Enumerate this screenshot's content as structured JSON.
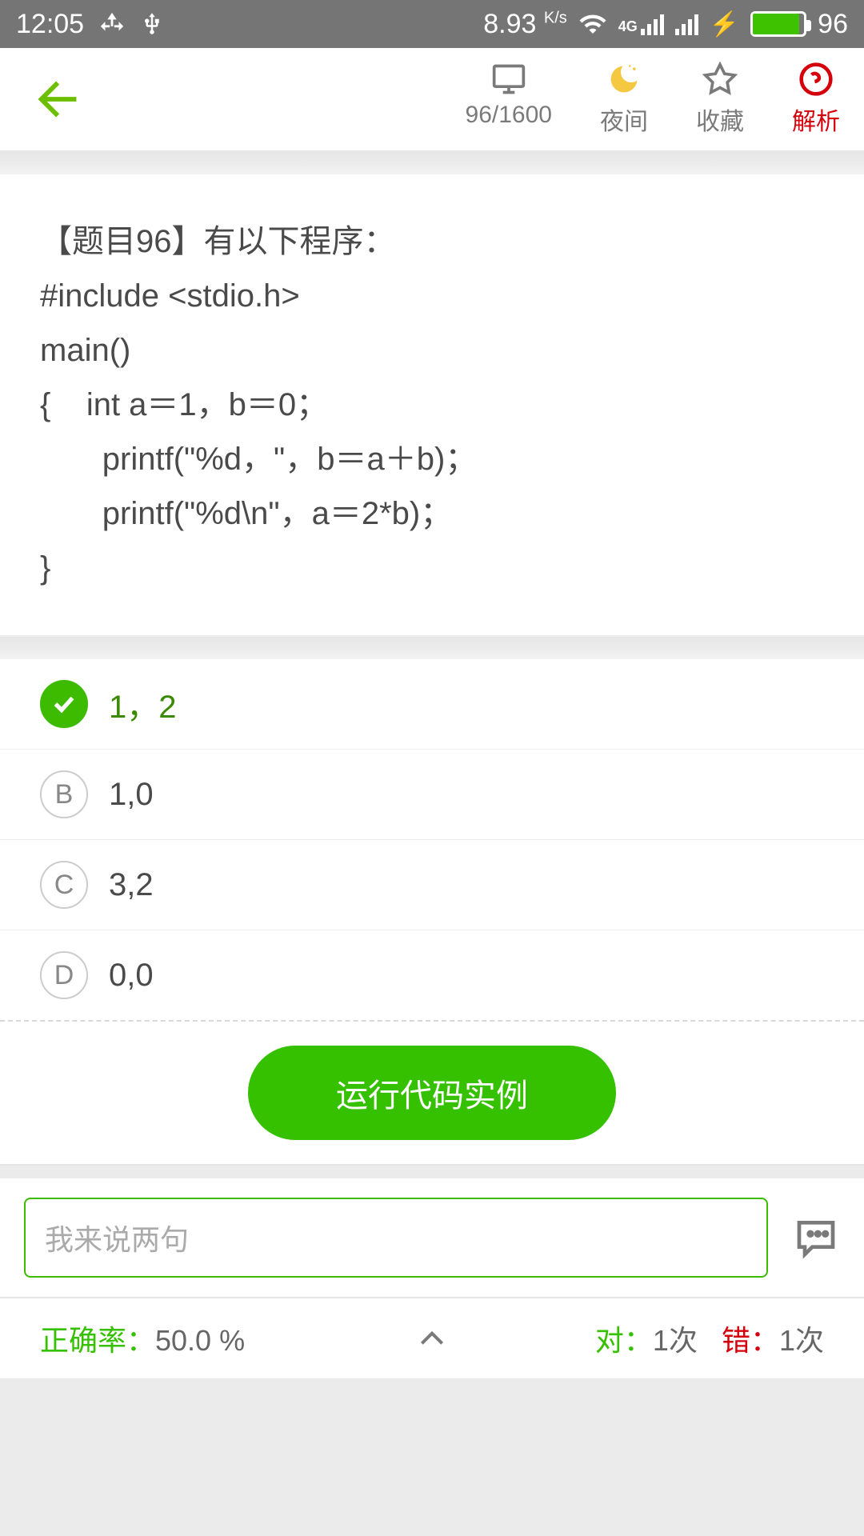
{
  "status": {
    "time": "12:05",
    "speed_val": "8.93",
    "speed_unit": "K/s",
    "battery": "96"
  },
  "toolbar": {
    "counter": "96/1600",
    "night": "夜间",
    "fav": "收藏",
    "analysis": "解析"
  },
  "question": {
    "line1": "【题目96】有以下程序：",
    "line2": "#include  <stdio.h>",
    "line3": "main()",
    "line4": "{    int a＝1，b＝0；",
    "line5": "       printf(\"%d，\"，b＝a＋b)；",
    "line6": "       printf(\"%d\\n\"，a＝2*b)；",
    "line7": "}"
  },
  "options": {
    "a": {
      "text": "1，2"
    },
    "b": {
      "label": "B",
      "text": "1,0"
    },
    "c": {
      "label": "C",
      "text": "3,2"
    },
    "d": {
      "label": "D",
      "text": "0,0"
    }
  },
  "run_button": "运行代码实例",
  "comment_placeholder": "我来说两句",
  "stats": {
    "accuracy_label": "正确率：",
    "accuracy_value": "50.0 %",
    "correct_label": "对：",
    "correct_value": "1次",
    "wrong_label": "错：",
    "wrong_value": "1次"
  }
}
